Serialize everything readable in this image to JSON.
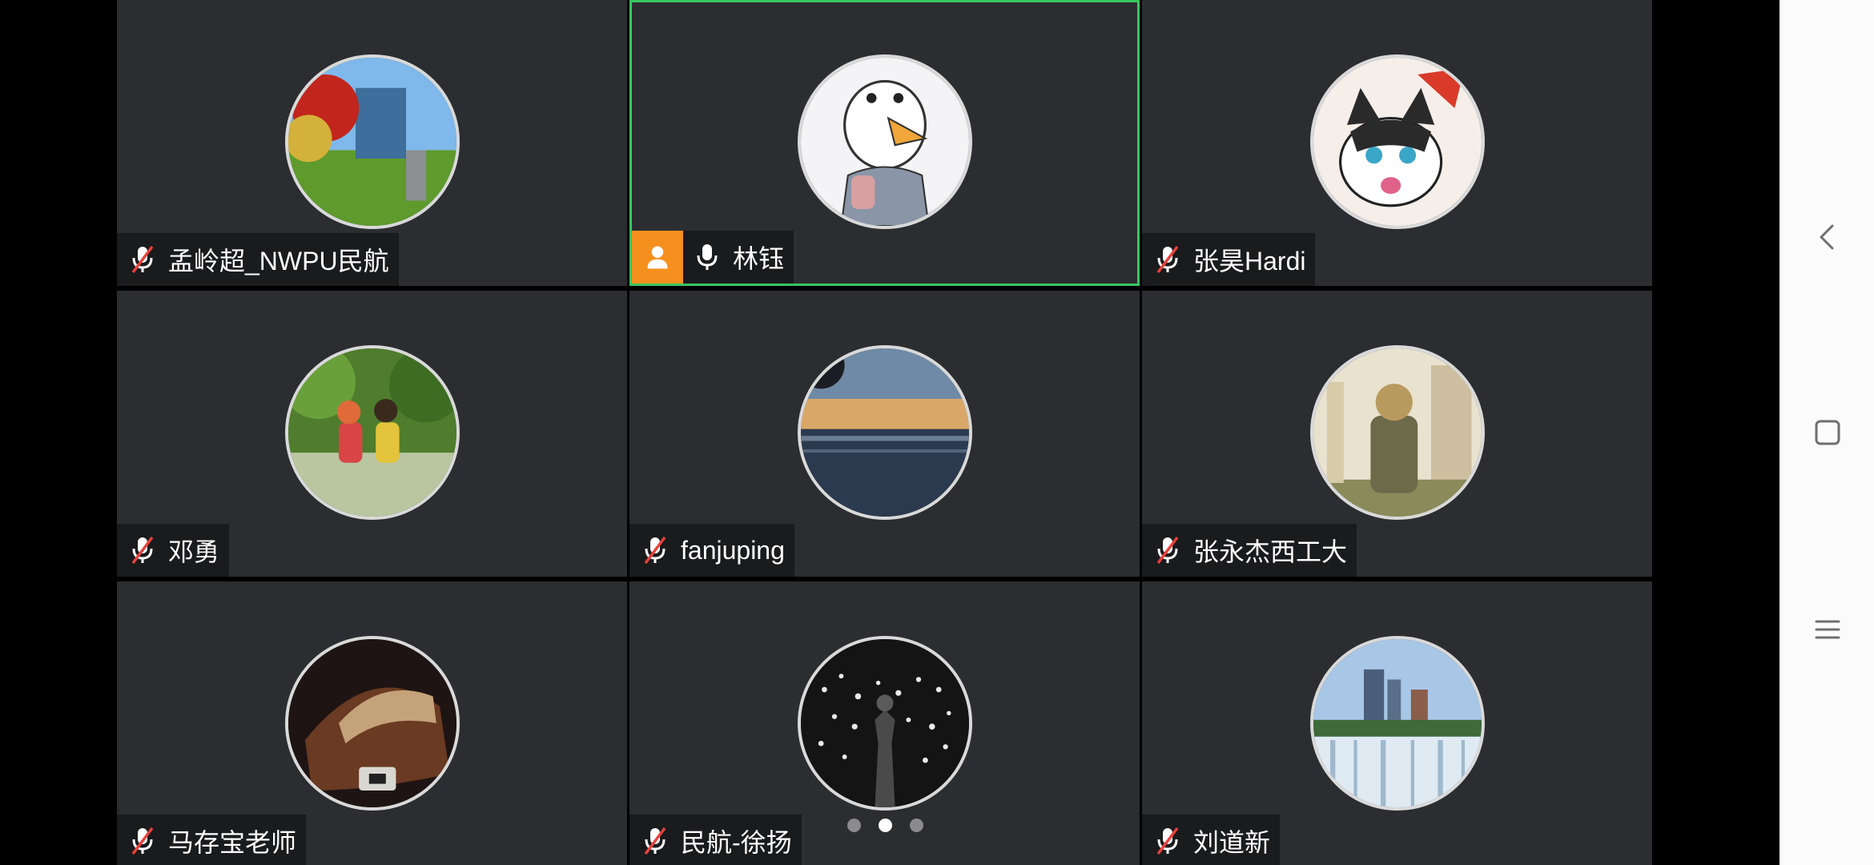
{
  "participants": [
    {
      "name": "孟岭超_NWPU民航",
      "muted": true,
      "host": false,
      "active": false
    },
    {
      "name": "林钰",
      "muted": false,
      "host": true,
      "active": true
    },
    {
      "name": "张昊Hardi",
      "muted": true,
      "host": false,
      "active": false
    },
    {
      "name": "邓勇",
      "muted": true,
      "host": false,
      "active": false
    },
    {
      "name": "fanjuping",
      "muted": true,
      "host": false,
      "active": false
    },
    {
      "name": "张永杰西工大",
      "muted": true,
      "host": false,
      "active": false
    },
    {
      "name": "马存宝老师",
      "muted": true,
      "host": false,
      "active": false
    },
    {
      "name": "民航-徐扬",
      "muted": true,
      "host": false,
      "active": false
    },
    {
      "name": "刘道新",
      "muted": true,
      "host": false,
      "active": false
    }
  ],
  "pager": {
    "pages": 3,
    "current": 2
  },
  "colors": {
    "tile_bg": "#2c2d30",
    "active_border": "#3ac561",
    "host_badge": "#f5901f",
    "muted_slash": "#e8413b"
  },
  "icons": {
    "muted": "mic-muted-icon",
    "unmuted": "mic-icon",
    "host": "person-icon",
    "nav_back": "chevron-left-icon",
    "nav_home": "square-icon",
    "nav_menu": "menu-icon"
  }
}
